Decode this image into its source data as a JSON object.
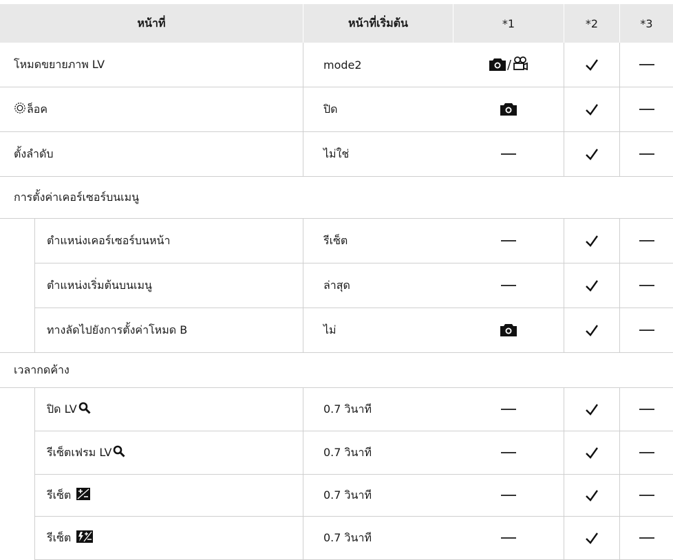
{
  "table": {
    "headers": {
      "function": "หน้าที่",
      "default": "หน้าที่เริ่มต้น",
      "col1": "*1",
      "col2": "*2",
      "col3": "*3"
    },
    "rows": [
      {
        "label": "โหมดขยายภาพ LV",
        "default": "mode2",
        "col1": "camera-movie-icon",
        "col2": "check",
        "col3": "dash"
      },
      {
        "label": "ล็อค",
        "label_prefix_icon": "dial-icon",
        "default": "ปิด",
        "col1": "camera-icon",
        "col2": "check",
        "col3": "dash"
      },
      {
        "label": "ตั้งลำดับ",
        "default": "ไม่ใช่",
        "col1": "dash",
        "col2": "check",
        "col3": "dash"
      },
      {
        "section": "การตั้งค่าเคอร์เซอร์บนเมนู"
      },
      {
        "label": "ตำแหน่งเคอร์เซอร์บนหน้า",
        "default": "รีเซ็ต",
        "col1": "dash",
        "col2": "check",
        "col3": "dash"
      },
      {
        "label": "ตำแหน่งเริ่มต้นบนเมนู",
        "default": "ล่าสุด",
        "col1": "dash",
        "col2": "check",
        "col3": "dash"
      },
      {
        "label": "ทางลัดไปยังการตั้งค่าโหมด B",
        "default": "ไม่",
        "col1": "camera-icon",
        "col2": "check",
        "col3": "dash"
      },
      {
        "section": "เวลากดค้าง"
      },
      {
        "label": "ปิด LV",
        "label_suffix_icon": "magnify-icon",
        "default": "0.7 วินาที",
        "col1": "dash",
        "col2": "check",
        "col3": "dash"
      },
      {
        "label": "รีเซ็ตเฟรม LV",
        "label_suffix_icon": "magnify-icon",
        "default": "0.7 วินาที",
        "col1": "dash",
        "col2": "check",
        "col3": "dash"
      },
      {
        "label": "รีเซ็ต",
        "label_suffix_icon": "exposure-comp-icon",
        "default": "0.7 วินาที",
        "col1": "dash",
        "col2": "check",
        "col3": "dash"
      },
      {
        "label": "รีเซ็ต",
        "label_suffix_icon": "flash-exposure-comp-icon",
        "default": "0.7 วินาที",
        "col1": "dash",
        "col2": "check",
        "col3": "dash"
      }
    ]
  }
}
